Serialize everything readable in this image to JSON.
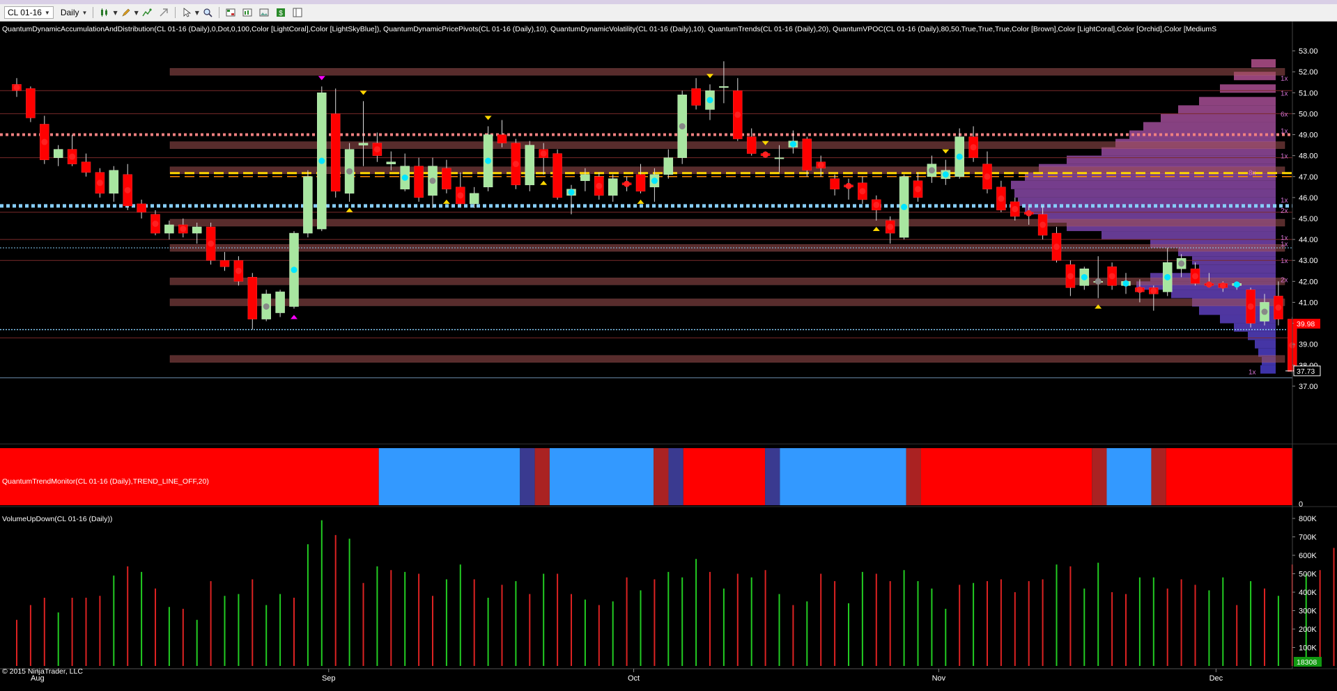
{
  "toolbar": {
    "instrument": "CL 01-16",
    "interval": "Daily"
  },
  "indicators": {
    "price_panel_label": "QuantumDynamicAccumulationAndDistribution(CL 01-16 (Daily),0,Dot,0,100,Color [LightCoral],Color [LightSkyBlue]), QuantumDynamicPricePivots(CL 01-16 (Daily),10), QuantumDynamicVolatility(CL 01-16 (Daily),10), QuantumTrends(CL 01-16 (Daily),20), QuantumVPOC(CL 01-16 (Daily),80,50,True,True,True,Color [Brown],Color [LightCoral],Color [Orchid],Color [MediumS",
    "trend_panel_label": "QuantumTrendMonitor(CL 01-16 (Daily),TREND_LINE_OFF,20)",
    "volume_panel_label": "VolumeUpDown(CL 01-16 (Daily))"
  },
  "copyright": "© 2015 NinjaTrader, LLC",
  "colors": {
    "background": "#000000",
    "up_candle": "#a8e6a0",
    "down_candle": "#ff0000",
    "vol_up": "#22cc22",
    "vol_down": "#dd2222",
    "trend_red": "#ff0000",
    "trend_blue": "#3399ff",
    "trend_navy": "#3a3a90",
    "trend_brown": "#aa2222",
    "accum_line": "#f08080",
    "dist_line": "#87cefa",
    "vpoc_line": "#ffd700"
  },
  "chart_data": {
    "type": "candlestick",
    "instrument": "CL 01-16",
    "interval": "Daily",
    "price_axis_ticks": [
      "53.00",
      "52.00",
      "51.00",
      "50.00",
      "49.00",
      "48.00",
      "47.00",
      "46.00",
      "45.00",
      "44.00",
      "43.00",
      "42.00",
      "41.00",
      "40.00",
      "39.00",
      "38.00",
      "37.00"
    ],
    "price_range": [
      36.5,
      53.4
    ],
    "x_axis_labels": [
      {
        "label": "Aug",
        "bar": 1.5
      },
      {
        "label": "Sep",
        "bar": 22.5
      },
      {
        "label": "Oct",
        "bar": 44.5
      },
      {
        "label": "Nov",
        "bar": 66.5
      },
      {
        "label": "Dec",
        "bar": 86.5
      }
    ],
    "last_price_label": "37.73",
    "prev_price_label": "39.98",
    "candles": [
      [
        51.4,
        51.7,
        50.8,
        51.1
      ],
      [
        51.2,
        51.3,
        49.6,
        49.8
      ],
      [
        49.5,
        49.9,
        47.6,
        47.8
      ],
      [
        47.9,
        48.5,
        47.5,
        48.3
      ],
      [
        48.3,
        49.0,
        47.5,
        47.6
      ],
      [
        47.7,
        48.1,
        47.0,
        47.2
      ],
      [
        47.2,
        47.4,
        46.0,
        46.2
      ],
      [
        46.2,
        47.5,
        45.8,
        47.3
      ],
      [
        47.1,
        47.6,
        45.4,
        45.6
      ],
      [
        45.7,
        45.9,
        45.0,
        45.3
      ],
      [
        45.2,
        45.4,
        44.2,
        44.3
      ],
      [
        44.3,
        44.9,
        44.0,
        44.7
      ],
      [
        44.7,
        45.0,
        44.1,
        44.3
      ],
      [
        44.3,
        44.8,
        43.8,
        44.6
      ],
      [
        44.6,
        44.8,
        42.8,
        43.0
      ],
      [
        43.0,
        43.4,
        42.5,
        42.7
      ],
      [
        43.0,
        43.2,
        41.8,
        42.0
      ],
      [
        42.2,
        42.4,
        39.7,
        40.2
      ],
      [
        40.2,
        41.6,
        40.1,
        41.4
      ],
      [
        40.5,
        41.6,
        40.3,
        41.5
      ],
      [
        40.8,
        44.4,
        40.7,
        44.3
      ],
      [
        44.3,
        47.3,
        44.1,
        47.0
      ],
      [
        44.5,
        51.3,
        44.4,
        51.0
      ],
      [
        50.0,
        51.2,
        46.0,
        46.3
      ],
      [
        46.2,
        48.6,
        45.8,
        48.3
      ],
      [
        48.5,
        50.6,
        47.5,
        48.6
      ],
      [
        48.6,
        49.1,
        47.7,
        48.0
      ],
      [
        47.6,
        48.2,
        47.3,
        47.7
      ],
      [
        46.4,
        48.1,
        46.3,
        47.5
      ],
      [
        47.5,
        47.9,
        45.8,
        46.0
      ],
      [
        46.1,
        47.9,
        45.5,
        47.5
      ],
      [
        47.4,
        47.8,
        46.2,
        46.4
      ],
      [
        46.5,
        47.2,
        45.6,
        45.7
      ],
      [
        45.7,
        46.5,
        45.5,
        46.2
      ],
      [
        46.5,
        49.4,
        46.3,
        49.0
      ],
      [
        49.0,
        49.7,
        48.4,
        48.6
      ],
      [
        48.6,
        48.8,
        46.4,
        46.6
      ],
      [
        46.6,
        48.7,
        46.3,
        48.5
      ],
      [
        48.3,
        48.6,
        47.1,
        47.9
      ],
      [
        48.1,
        48.3,
        45.9,
        46.0
      ],
      [
        46.1,
        46.6,
        45.2,
        46.4
      ],
      [
        46.8,
        47.4,
        46.3,
        47.1
      ],
      [
        47.0,
        47.2,
        45.9,
        46.1
      ],
      [
        46.1,
        47.1,
        45.8,
        46.9
      ],
      [
        46.7,
        47.0,
        46.3,
        46.6
      ],
      [
        47.1,
        47.6,
        46.2,
        46.3
      ],
      [
        46.5,
        47.4,
        45.8,
        47.1
      ],
      [
        47.1,
        48.3,
        46.9,
        47.9
      ],
      [
        47.9,
        51.1,
        47.6,
        50.9
      ],
      [
        51.2,
        51.7,
        50.2,
        50.4
      ],
      [
        50.2,
        51.4,
        49.7,
        51.1
      ],
      [
        51.3,
        52.5,
        50.5,
        51.3
      ],
      [
        51.1,
        51.7,
        48.7,
        48.8
      ],
      [
        48.9,
        49.3,
        48.0,
        48.1
      ],
      [
        48.1,
        48.2,
        47.9,
        48.0
      ],
      [
        47.9,
        48.5,
        47.2,
        47.9
      ],
      [
        48.4,
        49.2,
        48.1,
        48.7
      ],
      [
        48.8,
        48.9,
        47.0,
        47.3
      ],
      [
        47.7,
        48.0,
        47.0,
        47.4
      ],
      [
        46.9,
        47.1,
        46.1,
        46.4
      ],
      [
        46.6,
        46.9,
        45.9,
        46.5
      ],
      [
        46.7,
        47.0,
        45.7,
        45.9
      ],
      [
        45.9,
        46.1,
        44.9,
        45.4
      ],
      [
        44.9,
        45.1,
        43.8,
        44.3
      ],
      [
        44.1,
        47.1,
        44.0,
        47.0
      ],
      [
        46.8,
        47.2,
        45.8,
        46.0
      ],
      [
        47.0,
        48.0,
        46.7,
        47.6
      ],
      [
        46.9,
        47.8,
        46.6,
        47.3
      ],
      [
        47.0,
        49.3,
        46.9,
        48.9
      ],
      [
        48.9,
        49.4,
        47.7,
        47.9
      ],
      [
        47.6,
        48.2,
        46.2,
        46.4
      ],
      [
        46.5,
        46.8,
        45.3,
        45.4
      ],
      [
        45.8,
        46.0,
        44.9,
        45.1
      ],
      [
        45.3,
        45.6,
        44.7,
        45.2
      ],
      [
        45.2,
        45.6,
        44.0,
        44.2
      ],
      [
        44.3,
        44.6,
        42.9,
        43.0
      ],
      [
        42.8,
        43.0,
        41.3,
        41.7
      ],
      [
        41.8,
        42.7,
        41.6,
        42.6
      ],
      [
        42.0,
        43.2,
        41.2,
        42.0
      ],
      [
        42.7,
        42.9,
        41.6,
        41.8
      ],
      [
        41.8,
        42.4,
        41.4,
        42.0
      ],
      [
        41.7,
        42.1,
        41.0,
        41.5
      ],
      [
        41.7,
        41.8,
        40.6,
        41.4
      ],
      [
        41.5,
        43.6,
        41.3,
        42.9
      ],
      [
        42.6,
        43.3,
        42.2,
        43.1
      ],
      [
        42.6,
        42.9,
        41.8,
        41.9
      ],
      [
        41.9,
        42.4,
        41.7,
        41.8
      ],
      [
        41.9,
        42.0,
        41.5,
        41.7
      ],
      [
        41.8,
        42.0,
        41.6,
        41.9
      ],
      [
        41.6,
        41.7,
        39.8,
        40.0
      ],
      [
        40.1,
        41.4,
        39.9,
        41.0
      ],
      [
        41.3,
        42.0,
        39.9,
        40.2
      ],
      [
        40.2,
        40.3,
        37.6,
        37.7
      ]
    ],
    "volume_axis_ticks": [
      "800K",
      "700K",
      "600K",
      "500K",
      "400K",
      "300K",
      "200K",
      "100K"
    ],
    "volume_range": [
      0,
      800000
    ],
    "last_volume_label": "18308",
    "volume": [
      [
        250,
        "d"
      ],
      [
        330,
        "d"
      ],
      [
        370,
        "d"
      ],
      [
        290,
        "u"
      ],
      [
        370,
        "d"
      ],
      [
        370,
        "d"
      ],
      [
        380,
        "d"
      ],
      [
        490,
        "u"
      ],
      [
        540,
        "d"
      ],
      [
        510,
        "u"
      ],
      [
        420,
        "d"
      ],
      [
        320,
        "u"
      ],
      [
        310,
        "d"
      ],
      [
        250,
        "u"
      ],
      [
        460,
        "d"
      ],
      [
        380,
        "u"
      ],
      [
        390,
        "u"
      ],
      [
        470,
        "d"
      ],
      [
        330,
        "u"
      ],
      [
        390,
        "u"
      ],
      [
        370,
        "d"
      ],
      [
        660,
        "u"
      ],
      [
        790,
        "u"
      ],
      [
        710,
        "d"
      ],
      [
        690,
        "u"
      ],
      [
        450,
        "d"
      ],
      [
        540,
        "u"
      ],
      [
        520,
        "d"
      ],
      [
        510,
        "u"
      ],
      [
        500,
        "d"
      ],
      [
        380,
        "d"
      ],
      [
        470,
        "u"
      ],
      [
        550,
        "u"
      ],
      [
        470,
        "d"
      ],
      [
        370,
        "u"
      ],
      [
        440,
        "d"
      ],
      [
        460,
        "u"
      ],
      [
        390,
        "d"
      ],
      [
        500,
        "u"
      ],
      [
        500,
        "d"
      ],
      [
        390,
        "d"
      ],
      [
        360,
        "u"
      ],
      [
        330,
        "d"
      ],
      [
        350,
        "u"
      ],
      [
        480,
        "d"
      ],
      [
        410,
        "u"
      ],
      [
        470,
        "d"
      ],
      [
        510,
        "u"
      ],
      [
        480,
        "u"
      ],
      [
        580,
        "u"
      ],
      [
        510,
        "d"
      ],
      [
        420,
        "u"
      ],
      [
        500,
        "d"
      ],
      [
        480,
        "u"
      ],
      [
        520,
        "d"
      ],
      [
        390,
        "u"
      ],
      [
        330,
        "d"
      ],
      [
        350,
        "u"
      ],
      [
        500,
        "d"
      ],
      [
        460,
        "d"
      ],
      [
        340,
        "u"
      ],
      [
        510,
        "u"
      ],
      [
        500,
        "d"
      ],
      [
        460,
        "d"
      ],
      [
        520,
        "u"
      ],
      [
        460,
        "u"
      ],
      [
        420,
        "u"
      ],
      [
        310,
        "u"
      ],
      [
        440,
        "d"
      ],
      [
        450,
        "u"
      ],
      [
        460,
        "d"
      ],
      [
        470,
        "d"
      ],
      [
        400,
        "d"
      ],
      [
        460,
        "d"
      ],
      [
        470,
        "d"
      ],
      [
        550,
        "u"
      ],
      [
        540,
        "d"
      ],
      [
        420,
        "u"
      ],
      [
        560,
        "u"
      ],
      [
        400,
        "d"
      ],
      [
        390,
        "d"
      ],
      [
        480,
        "u"
      ],
      [
        480,
        "u"
      ],
      [
        420,
        "d"
      ],
      [
        470,
        "d"
      ],
      [
        440,
        "d"
      ],
      [
        410,
        "u"
      ],
      [
        480,
        "u"
      ],
      [
        330,
        "d"
      ],
      [
        460,
        "u"
      ],
      [
        420,
        "d"
      ],
      [
        380,
        "u"
      ],
      [
        550,
        "d"
      ],
      [
        500,
        "u"
      ],
      [
        520,
        "d"
      ],
      [
        640,
        "d"
      ],
      [
        18,
        "u"
      ]
    ],
    "trend_segments": [
      [
        "red",
        0,
        25.5
      ],
      [
        "blue",
        25.5,
        35
      ],
      [
        "navy",
        35,
        36
      ],
      [
        "brown",
        36,
        37
      ],
      [
        "blue",
        37,
        44
      ],
      [
        "brown",
        44,
        45
      ],
      [
        "navy",
        45,
        46
      ],
      [
        "red",
        46,
        51.5
      ],
      [
        "navy",
        51.5,
        52.5
      ],
      [
        "blue",
        52.5,
        61
      ],
      [
        "brown",
        61,
        62
      ],
      [
        "red",
        62,
        73.5
      ],
      [
        "brown",
        73.5,
        74.5
      ],
      [
        "blue",
        74.5,
        77.5
      ],
      [
        "brown",
        77.5,
        78.5
      ],
      [
        "red",
        78.5,
        87
      ]
    ],
    "accumulation_level": 49.0,
    "distribution_level": 45.6,
    "vpoc_level": 47.1,
    "support_resistance_zones": [
      52.0,
      48.5,
      47.3,
      44.8,
      43.6,
      42.0,
      41.0,
      38.3
    ],
    "thin_levels": [
      51.1,
      50.0,
      47.9,
      45.3,
      44.0,
      43.0,
      39.3,
      37.4
    ],
    "vpoc_profile_labels": [
      "1x",
      "1x",
      "6x",
      "1x",
      "1x",
      "8x",
      "1x",
      "2x",
      "1x",
      "1x",
      "1x",
      "2x",
      "1x"
    ]
  }
}
